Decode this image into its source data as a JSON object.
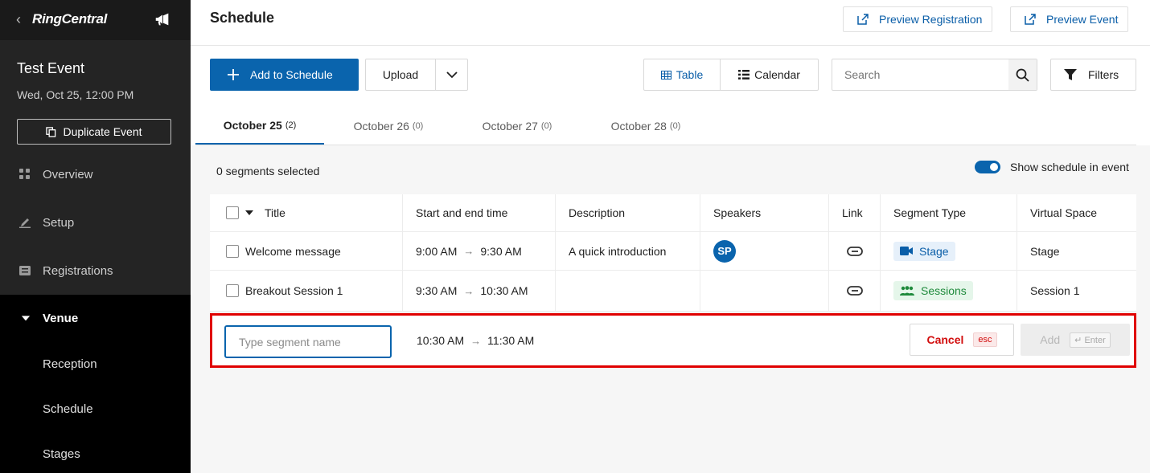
{
  "sidebar": {
    "back_glyph": "‹",
    "brand": "RingCentral",
    "event_name": "Test Event",
    "event_date": "Wed, Oct 25, 12:00 PM",
    "duplicate_label": "Duplicate Event",
    "nav": {
      "overview": "Overview",
      "setup": "Setup",
      "registrations": "Registrations",
      "venue": "Venue"
    },
    "venue_sub": {
      "reception": "Reception",
      "schedule": "Schedule",
      "stages": "Stages"
    }
  },
  "header": {
    "title": "Schedule",
    "preview_registration": "Preview Registration",
    "preview_event": "Preview Event"
  },
  "toolbar": {
    "add_label": "Add to Schedule",
    "upload_label": "Upload",
    "view_table": "Table",
    "view_calendar": "Calendar",
    "search_placeholder": "Search",
    "filters_label": "Filters"
  },
  "tabs": [
    {
      "label": "October 25",
      "count": "(2)"
    },
    {
      "label": "October 26",
      "count": "(0)"
    },
    {
      "label": "October 27",
      "count": "(0)"
    },
    {
      "label": "October 28",
      "count": "(0)"
    }
  ],
  "selection_status": "0 segments selected",
  "show_schedule_label": "Show schedule in event",
  "table": {
    "columns": {
      "title": "Title",
      "time": "Start and end time",
      "description": "Description",
      "speakers": "Speakers",
      "link": "Link",
      "segment_type": "Segment Type",
      "virtual_space": "Virtual Space"
    },
    "rows": [
      {
        "title": "Welcome message",
        "start": "9:00 AM",
        "end": "9:30 AM",
        "description": "A quick introduction",
        "speaker_initials": "SP",
        "segment_type": "Stage",
        "virtual_space": "Stage"
      },
      {
        "title": "Breakout Session 1",
        "start": "9:30 AM",
        "end": "10:30 AM",
        "description": "",
        "speaker_initials": "",
        "segment_type": "Sessions",
        "virtual_space": "Session 1"
      }
    ]
  },
  "new_segment": {
    "placeholder": "Type segment name",
    "start": "10:30 AM",
    "end": "11:30 AM",
    "cancel_label": "Cancel",
    "cancel_key": "esc",
    "add_label": "Add",
    "add_key": "↵ Enter"
  },
  "colors": {
    "accent": "#0a64ad",
    "highlight_border": "#e00000",
    "cancel": "#d20d0d"
  }
}
